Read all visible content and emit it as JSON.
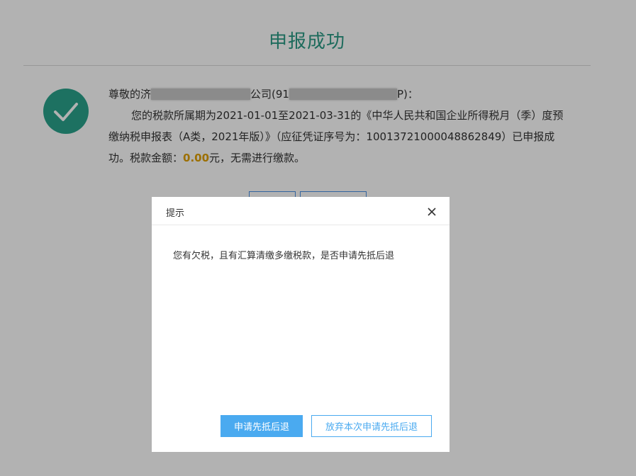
{
  "page": {
    "title": "申报成功",
    "message": {
      "greeting_prefix": "尊敬的济",
      "company_suffix": "公司(91",
      "tax_id_suffix": "P)：",
      "line2": "您的税款所属期为2021-01-01至2021-03-31的《中华人民共和国企业所得税月（季）度预",
      "line3": "缴纳税申报表（A类，2021年版）》（应征凭证序号为：10013721000048862849）已申报成",
      "line4_prefix": "功。税款金额：",
      "amount": "0.00",
      "line4_suffix": "元，无需进行缴款。"
    }
  },
  "dialog": {
    "title": "提示",
    "message": "您有欠税，且有汇算清缴多缴税款，是否申请先抵后退",
    "primary_button": "申请先抵后退",
    "secondary_button": "放弃本次申请先抵后退"
  },
  "colors": {
    "title_green": "#2a9a85",
    "success_green": "#2aa38c",
    "amount_orange": "#e0a000",
    "button_blue": "#4aaaf0"
  }
}
